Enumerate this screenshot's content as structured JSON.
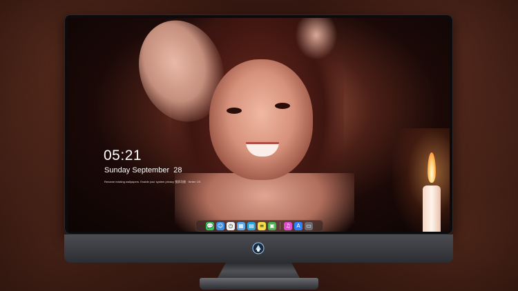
{
  "lockscreen": {
    "time": "05:21",
    "date": "Sunday September  28",
    "tip": "Rename existing wallpapers. Enable your system privacy 锁屏功能 · Better OS"
  },
  "dock": {
    "items": [
      {
        "name": "messages-icon",
        "color": "#34c759",
        "glyph": "💬"
      },
      {
        "name": "finder-icon",
        "color": "#3a8ee6",
        "glyph": "☺"
      },
      {
        "name": "clock-icon",
        "color": "#f2f2f2",
        "glyph": "◷"
      },
      {
        "name": "photos-icon",
        "color": "#5aa9e6",
        "glyph": "▦"
      },
      {
        "name": "clapper-icon",
        "color": "#2aa4d8",
        "glyph": "▤"
      },
      {
        "name": "notes-icon",
        "color": "#f5e04a",
        "glyph": "≡"
      },
      {
        "name": "preview-icon",
        "color": "#4caf50",
        "glyph": "▣"
      },
      {
        "name": "music-icon",
        "color": "#e14ccf",
        "glyph": "♫"
      },
      {
        "name": "app-store-icon",
        "color": "#2d7ff9",
        "glyph": "A"
      },
      {
        "name": "folder-icon",
        "color": "#6b6b70",
        "glyph": "▭"
      }
    ]
  },
  "colors": {
    "accent": "#2d7ff9",
    "bezel": "#0b0b0d",
    "chin": "#3a3b40"
  }
}
